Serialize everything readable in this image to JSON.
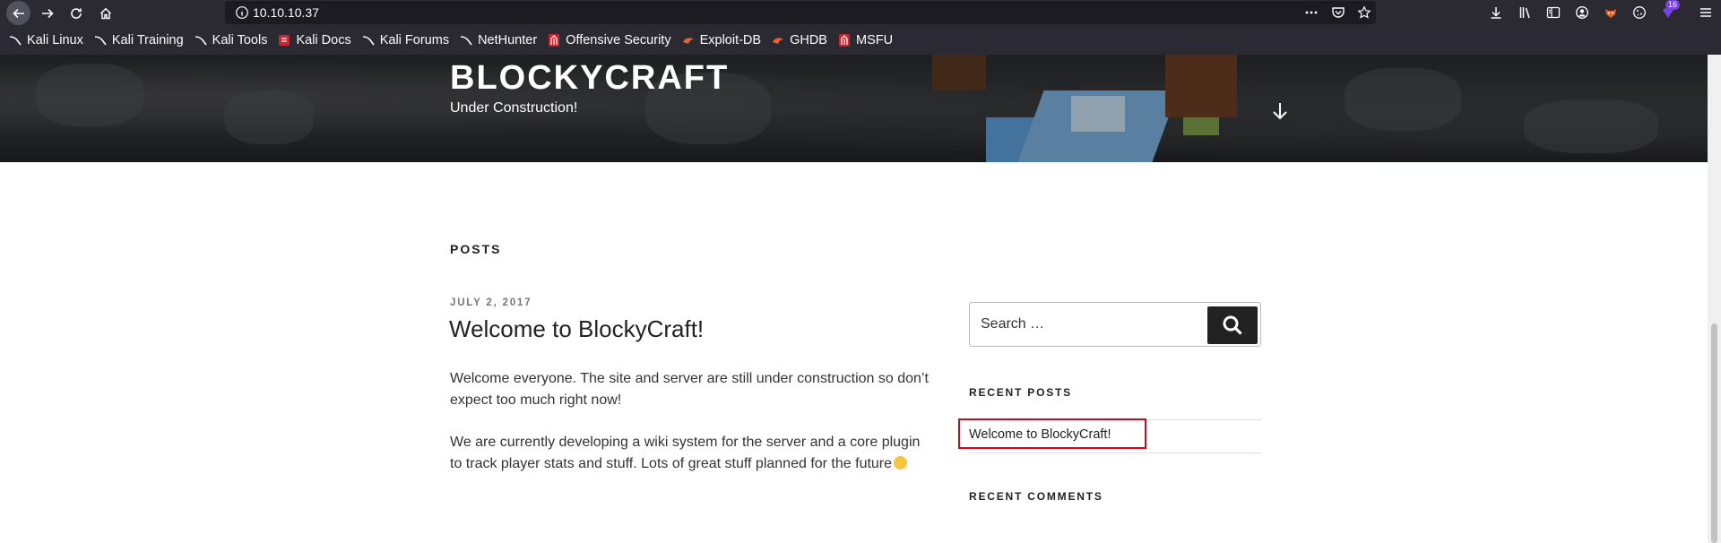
{
  "browser": {
    "url": "10.10.10.37",
    "notification_count": "16",
    "bookmarks": [
      {
        "label": "Kali Linux",
        "icon": "kali-dragon-icon"
      },
      {
        "label": "Kali Training",
        "icon": "kali-dragon-icon"
      },
      {
        "label": "Kali Tools",
        "icon": "kali-dragon-icon"
      },
      {
        "label": "Kali Docs",
        "icon": "kali-docs-icon"
      },
      {
        "label": "Kali Forums",
        "icon": "kali-dragon-icon"
      },
      {
        "label": "NetHunter",
        "icon": "kali-dragon-icon"
      },
      {
        "label": "Offensive Security",
        "icon": "offsec-icon"
      },
      {
        "label": "Exploit-DB",
        "icon": "exploitdb-icon"
      },
      {
        "label": "GHDB",
        "icon": "exploitdb-icon"
      },
      {
        "label": "MSFU",
        "icon": "offsec-icon"
      }
    ]
  },
  "site": {
    "title": "BLOCKYCRAFT",
    "description": "Under Construction!"
  },
  "main": {
    "section_title": "POSTS",
    "post": {
      "date": "JULY 2, 2017",
      "title": "Welcome to BlockyCraft!",
      "paragraphs": [
        "Welcome everyone. The site and server are still under construction so don’t expect too much right now!",
        "We are currently developing a wiki system for the server and a core plugin to track player stats and stuff. Lots of great stuff planned for the future"
      ]
    }
  },
  "sidebar": {
    "search_placeholder": "Search …",
    "recent_posts_title": "RECENT POSTS",
    "recent_posts": [
      "Welcome to BlockyCraft!"
    ],
    "recent_comments_title": "RECENT COMMENTS"
  },
  "colors": {
    "chrome_bg": "#2b2a33",
    "urlbar_bg": "#1c1b22",
    "highlight": "#d9001a",
    "badge": "#7542e5"
  }
}
